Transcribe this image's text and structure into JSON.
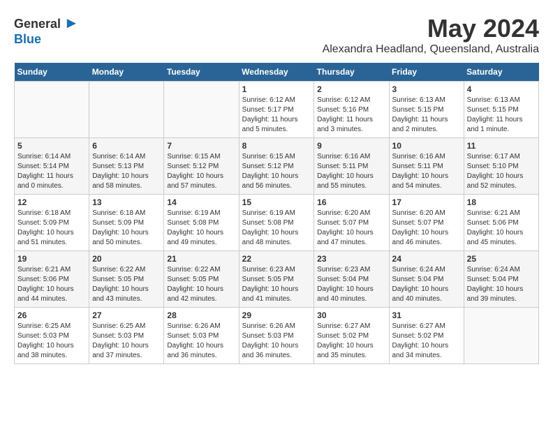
{
  "header": {
    "logo_general": "General",
    "logo_blue": "Blue",
    "month": "May 2024",
    "location": "Alexandra Headland, Queensland, Australia"
  },
  "days_of_week": [
    "Sunday",
    "Monday",
    "Tuesday",
    "Wednesday",
    "Thursday",
    "Friday",
    "Saturday"
  ],
  "weeks": [
    [
      {
        "day": "",
        "info": ""
      },
      {
        "day": "",
        "info": ""
      },
      {
        "day": "",
        "info": ""
      },
      {
        "day": "1",
        "info": "Sunrise: 6:12 AM\nSunset: 5:17 PM\nDaylight: 11 hours\nand 5 minutes."
      },
      {
        "day": "2",
        "info": "Sunrise: 6:12 AM\nSunset: 5:16 PM\nDaylight: 11 hours\nand 3 minutes."
      },
      {
        "day": "3",
        "info": "Sunrise: 6:13 AM\nSunset: 5:15 PM\nDaylight: 11 hours\nand 2 minutes."
      },
      {
        "day": "4",
        "info": "Sunrise: 6:13 AM\nSunset: 5:15 PM\nDaylight: 11 hours\nand 1 minute."
      }
    ],
    [
      {
        "day": "5",
        "info": "Sunrise: 6:14 AM\nSunset: 5:14 PM\nDaylight: 11 hours\nand 0 minutes."
      },
      {
        "day": "6",
        "info": "Sunrise: 6:14 AM\nSunset: 5:13 PM\nDaylight: 10 hours\nand 58 minutes."
      },
      {
        "day": "7",
        "info": "Sunrise: 6:15 AM\nSunset: 5:12 PM\nDaylight: 10 hours\nand 57 minutes."
      },
      {
        "day": "8",
        "info": "Sunrise: 6:15 AM\nSunset: 5:12 PM\nDaylight: 10 hours\nand 56 minutes."
      },
      {
        "day": "9",
        "info": "Sunrise: 6:16 AM\nSunset: 5:11 PM\nDaylight: 10 hours\nand 55 minutes."
      },
      {
        "day": "10",
        "info": "Sunrise: 6:16 AM\nSunset: 5:11 PM\nDaylight: 10 hours\nand 54 minutes."
      },
      {
        "day": "11",
        "info": "Sunrise: 6:17 AM\nSunset: 5:10 PM\nDaylight: 10 hours\nand 52 minutes."
      }
    ],
    [
      {
        "day": "12",
        "info": "Sunrise: 6:18 AM\nSunset: 5:09 PM\nDaylight: 10 hours\nand 51 minutes."
      },
      {
        "day": "13",
        "info": "Sunrise: 6:18 AM\nSunset: 5:09 PM\nDaylight: 10 hours\nand 50 minutes."
      },
      {
        "day": "14",
        "info": "Sunrise: 6:19 AM\nSunset: 5:08 PM\nDaylight: 10 hours\nand 49 minutes."
      },
      {
        "day": "15",
        "info": "Sunrise: 6:19 AM\nSunset: 5:08 PM\nDaylight: 10 hours\nand 48 minutes."
      },
      {
        "day": "16",
        "info": "Sunrise: 6:20 AM\nSunset: 5:07 PM\nDaylight: 10 hours\nand 47 minutes."
      },
      {
        "day": "17",
        "info": "Sunrise: 6:20 AM\nSunset: 5:07 PM\nDaylight: 10 hours\nand 46 minutes."
      },
      {
        "day": "18",
        "info": "Sunrise: 6:21 AM\nSunset: 5:06 PM\nDaylight: 10 hours\nand 45 minutes."
      }
    ],
    [
      {
        "day": "19",
        "info": "Sunrise: 6:21 AM\nSunset: 5:06 PM\nDaylight: 10 hours\nand 44 minutes."
      },
      {
        "day": "20",
        "info": "Sunrise: 6:22 AM\nSunset: 5:05 PM\nDaylight: 10 hours\nand 43 minutes."
      },
      {
        "day": "21",
        "info": "Sunrise: 6:22 AM\nSunset: 5:05 PM\nDaylight: 10 hours\nand 42 minutes."
      },
      {
        "day": "22",
        "info": "Sunrise: 6:23 AM\nSunset: 5:05 PM\nDaylight: 10 hours\nand 41 minutes."
      },
      {
        "day": "23",
        "info": "Sunrise: 6:23 AM\nSunset: 5:04 PM\nDaylight: 10 hours\nand 40 minutes."
      },
      {
        "day": "24",
        "info": "Sunrise: 6:24 AM\nSunset: 5:04 PM\nDaylight: 10 hours\nand 40 minutes."
      },
      {
        "day": "25",
        "info": "Sunrise: 6:24 AM\nSunset: 5:04 PM\nDaylight: 10 hours\nand 39 minutes."
      }
    ],
    [
      {
        "day": "26",
        "info": "Sunrise: 6:25 AM\nSunset: 5:03 PM\nDaylight: 10 hours\nand 38 minutes."
      },
      {
        "day": "27",
        "info": "Sunrise: 6:25 AM\nSunset: 5:03 PM\nDaylight: 10 hours\nand 37 minutes."
      },
      {
        "day": "28",
        "info": "Sunrise: 6:26 AM\nSunset: 5:03 PM\nDaylight: 10 hours\nand 36 minutes."
      },
      {
        "day": "29",
        "info": "Sunrise: 6:26 AM\nSunset: 5:03 PM\nDaylight: 10 hours\nand 36 minutes."
      },
      {
        "day": "30",
        "info": "Sunrise: 6:27 AM\nSunset: 5:02 PM\nDaylight: 10 hours\nand 35 minutes."
      },
      {
        "day": "31",
        "info": "Sunrise: 6:27 AM\nSunset: 5:02 PM\nDaylight: 10 hours\nand 34 minutes."
      },
      {
        "day": "",
        "info": ""
      }
    ]
  ]
}
